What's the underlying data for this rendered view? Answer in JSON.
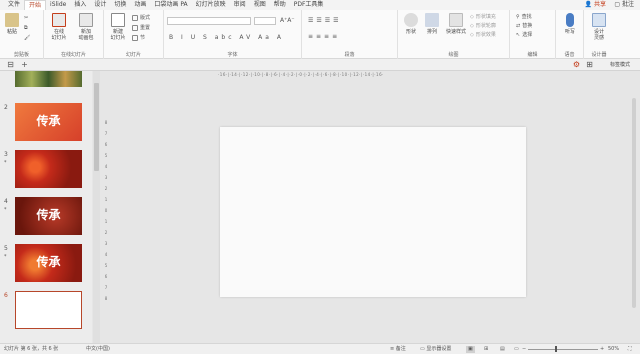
{
  "menu": {
    "items": [
      "文件",
      "开始",
      "iSlide",
      "插入",
      "设计",
      "切换",
      "动画",
      "口袋动画 PA",
      "幻灯片放映",
      "审阅",
      "视图",
      "帮助",
      "PDF工具集"
    ],
    "active_index": 1,
    "share": "共享",
    "comment": "批注"
  },
  "ribbon": {
    "clipboard": {
      "paste": "粘贴",
      "label": "剪贴板"
    },
    "online": {
      "btn1": "在线\n幻灯片",
      "btn2": "新加\n动画包",
      "label": "在线幻灯片"
    },
    "slides": {
      "new_slide": "新建\n幻灯片",
      "layout": "版式",
      "reset": "重置",
      "section": "节",
      "label": "幻灯片"
    },
    "font": {
      "label": "字体",
      "buttons": "B I U S abc AV Aa A"
    },
    "paragraph": {
      "label": "段落"
    },
    "drawing": {
      "shape": "形状",
      "arrange": "排列",
      "quick_styles": "快速样式",
      "fill": "形状填充",
      "outline": "形状轮廓",
      "effect": "形状效果",
      "label": "绘图"
    },
    "editing": {
      "find": "查找",
      "replace": "替换",
      "select": "选择",
      "label": "编辑"
    },
    "voice": {
      "dictate": "听写",
      "label": "语音"
    },
    "designer": {
      "design_ideas": "设计\n灵感",
      "label": "设计器"
    }
  },
  "toolbar2": {
    "label": "标签模式"
  },
  "thumbnails": [
    {
      "num": "",
      "star": "",
      "title": "",
      "color": "#6b8a3a"
    },
    {
      "num": "2",
      "star": "",
      "title": "传承",
      "color": "#ea6a3c"
    },
    {
      "num": "3",
      "star": "*",
      "title": "",
      "color": "#c42a1a"
    },
    {
      "num": "4",
      "star": "*",
      "title": "传承",
      "color": "#8c2416"
    },
    {
      "num": "5",
      "star": "*",
      "title": "传承",
      "color": "#b8281a"
    },
    {
      "num": "6",
      "star": "",
      "title": "",
      "color": "#ffffff"
    }
  ],
  "ruler": {
    "h": "·16·|·14·|·12·|·10·|·8·|·6·|·4·|·2·|·0·|·2·|·4·|·6·|·8·|·10·|·12·|·14·|·16·",
    "v": [
      "8",
      "7",
      "6",
      "5",
      "4",
      "3",
      "2",
      "1",
      "0",
      "1",
      "2",
      "3",
      "4",
      "5",
      "6",
      "7",
      "8"
    ]
  },
  "status": {
    "slide_info": "幻灯片 第 6 张，共 6 张",
    "language": "中文(中国)",
    "notes": "备注",
    "display_settings": "显示器设置",
    "zoom_minus": "−",
    "zoom_plus": "+",
    "zoom": "50%"
  },
  "colors": {
    "accent": "#b7472a",
    "share": "#c43e1c"
  }
}
